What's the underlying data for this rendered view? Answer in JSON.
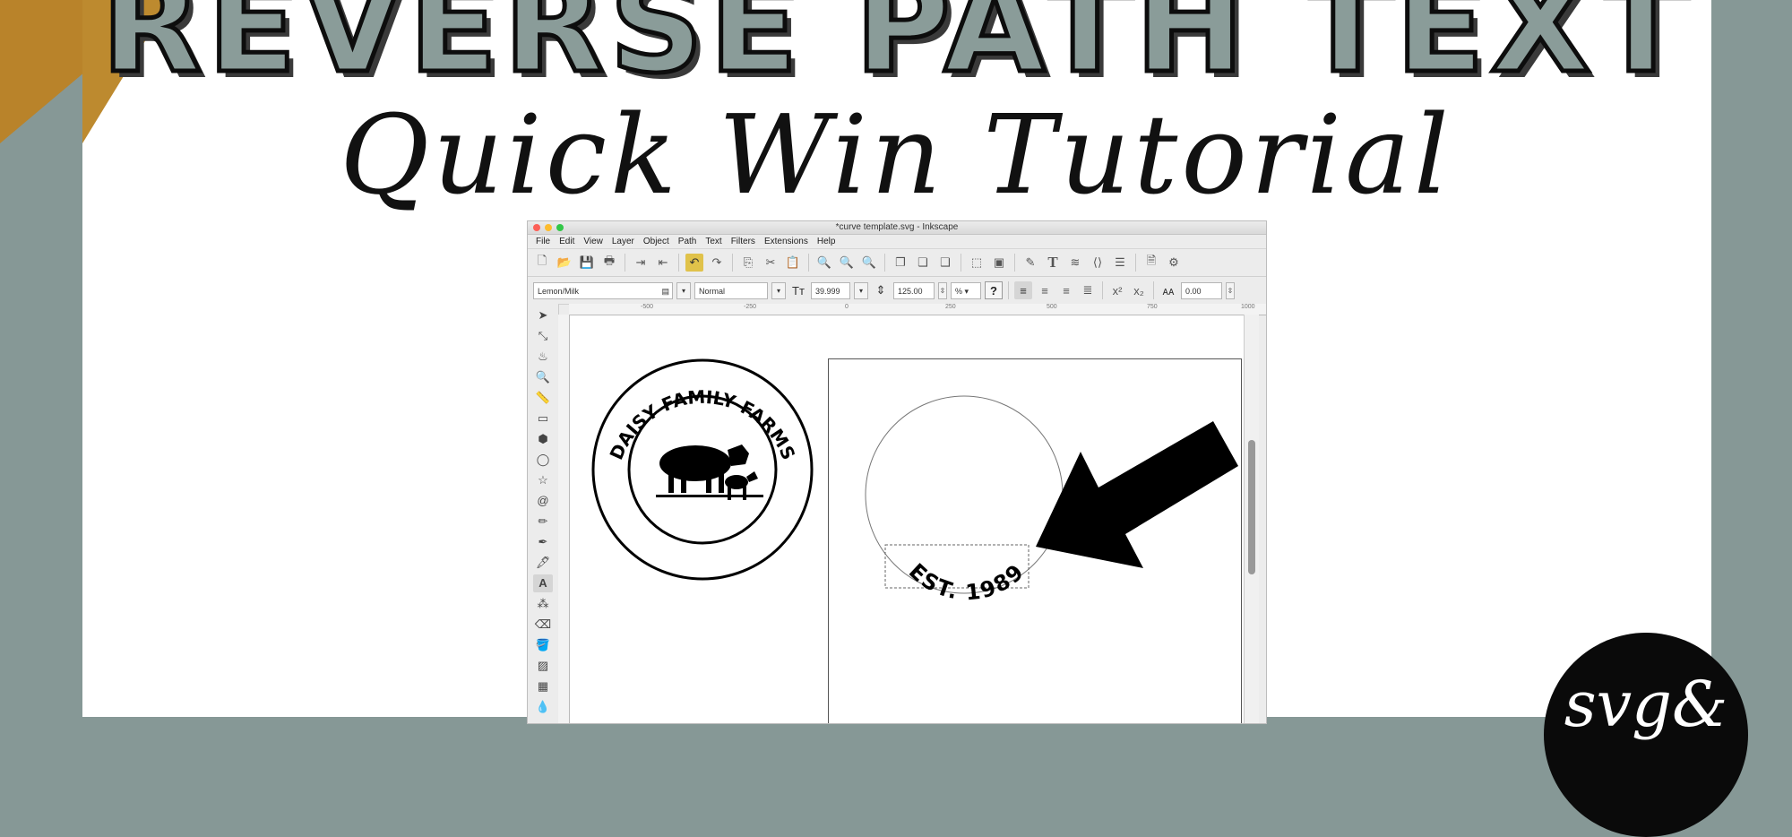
{
  "poster": {
    "title": "REVERSE PATH TEXT",
    "subtitle": "Quick Win Tutorial",
    "brand_badge": "svg&"
  },
  "window": {
    "title": "*curve template.svg - Inkscape",
    "traffic_lights": [
      "close",
      "minimize",
      "zoom"
    ]
  },
  "menu": [
    "File",
    "Edit",
    "View",
    "Layer",
    "Object",
    "Path",
    "Text",
    "Filters",
    "Extensions",
    "Help"
  ],
  "text_toolbar": {
    "font_family": "Lemon/Milk",
    "font_style": "Normal",
    "font_size": "39.999",
    "line_spacing": "125.00",
    "line_spacing_unit": "%",
    "letter_spacing": "0.00",
    "help_glyph": "?"
  },
  "ruler": {
    "ticks": [
      "-500",
      "-250",
      "0",
      "250",
      "500",
      "750",
      "1000"
    ]
  },
  "canvas": {
    "badge_top_text": "DAISY FAMILY FARMS",
    "curve_text": "EST. 1989"
  },
  "colors": {
    "background": "#869896",
    "title_fill": "#8a9c99",
    "gold_accent": "#bd8a2f",
    "active_tool": "#e0c24a"
  }
}
